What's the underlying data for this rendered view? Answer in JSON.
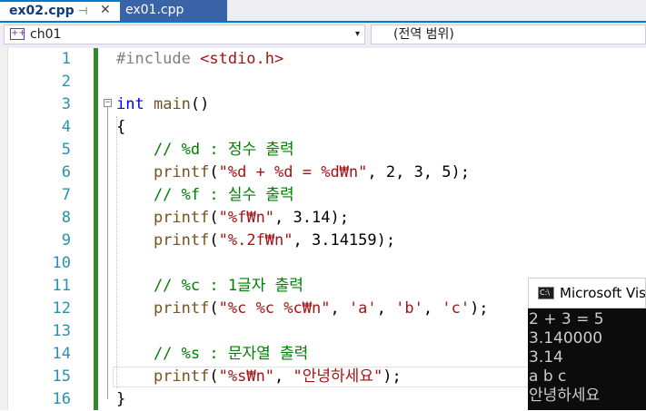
{
  "tabs": [
    {
      "label": "ex02.cpp",
      "active": true,
      "pin": "⊣",
      "close": "✕"
    },
    {
      "label": "ex01.cpp",
      "active": false
    }
  ],
  "navbar": {
    "scope_left": "ch01",
    "scope_right": "(전역 범위)",
    "dropdown_glyph": "▾"
  },
  "editor": {
    "lines": [
      {
        "n": "1",
        "segs": [
          {
            "t": "#include ",
            "c": "pp"
          },
          {
            "t": "<stdio.h>",
            "c": "str"
          }
        ]
      },
      {
        "n": "2",
        "segs": []
      },
      {
        "n": "3",
        "segs": [
          {
            "t": "int",
            "c": "kw"
          },
          {
            "t": " ",
            "c": ""
          },
          {
            "t": "main",
            "c": "fn"
          },
          {
            "t": "()",
            "c": ""
          }
        ]
      },
      {
        "n": "4",
        "segs": [
          {
            "t": "{",
            "c": ""
          }
        ]
      },
      {
        "n": "5",
        "segs": [
          {
            "t": "    // %d : 정수 출력",
            "c": "cm"
          }
        ]
      },
      {
        "n": "6",
        "segs": [
          {
            "t": "    ",
            "c": ""
          },
          {
            "t": "printf",
            "c": "fn"
          },
          {
            "t": "(",
            "c": ""
          },
          {
            "t": "\"%d + %d = %d₩n\"",
            "c": "str"
          },
          {
            "t": ", 2, 3, 5);",
            "c": ""
          }
        ]
      },
      {
        "n": "7",
        "segs": [
          {
            "t": "    // %f : 실수 출력",
            "c": "cm"
          }
        ]
      },
      {
        "n": "8",
        "segs": [
          {
            "t": "    ",
            "c": ""
          },
          {
            "t": "printf",
            "c": "fn"
          },
          {
            "t": "(",
            "c": ""
          },
          {
            "t": "\"%f₩n\"",
            "c": "str"
          },
          {
            "t": ", 3.14);",
            "c": ""
          }
        ]
      },
      {
        "n": "9",
        "segs": [
          {
            "t": "    ",
            "c": ""
          },
          {
            "t": "printf",
            "c": "fn"
          },
          {
            "t": "(",
            "c": ""
          },
          {
            "t": "\"%.2f₩n\"",
            "c": "str"
          },
          {
            "t": ", 3.14159);",
            "c": ""
          }
        ]
      },
      {
        "n": "10",
        "segs": []
      },
      {
        "n": "11",
        "segs": [
          {
            "t": "    // %c : 1글자 출력",
            "c": "cm"
          }
        ]
      },
      {
        "n": "12",
        "segs": [
          {
            "t": "    ",
            "c": ""
          },
          {
            "t": "printf",
            "c": "fn"
          },
          {
            "t": "(",
            "c": ""
          },
          {
            "t": "\"%c %c %c₩n\"",
            "c": "str"
          },
          {
            "t": ", ",
            "c": ""
          },
          {
            "t": "'a'",
            "c": "str"
          },
          {
            "t": ", ",
            "c": ""
          },
          {
            "t": "'b'",
            "c": "str"
          },
          {
            "t": ", ",
            "c": ""
          },
          {
            "t": "'c'",
            "c": "str"
          },
          {
            "t": ");",
            "c": ""
          }
        ]
      },
      {
        "n": "13",
        "segs": []
      },
      {
        "n": "14",
        "segs": [
          {
            "t": "    // %s : 문자열 출력",
            "c": "cm"
          }
        ]
      },
      {
        "n": "15",
        "segs": [
          {
            "t": "    ",
            "c": ""
          },
          {
            "t": "printf",
            "c": "fn"
          },
          {
            "t": "(",
            "c": ""
          },
          {
            "t": "\"%s₩n\"",
            "c": "str"
          },
          {
            "t": ", ",
            "c": ""
          },
          {
            "t": "\"안녕하세요\"",
            "c": "str"
          },
          {
            "t": ");",
            "c": ""
          }
        ]
      },
      {
        "n": "16",
        "segs": [
          {
            "t": "}",
            "c": ""
          }
        ]
      }
    ],
    "fold_glyph": "−"
  },
  "console": {
    "title": "Microsoft Visual Studio 디버그 콘솔",
    "icon_text": "C:\\",
    "output": [
      "2 + 3 = 5",
      "3.140000",
      "3.14",
      "a b c",
      "안녕하세요"
    ]
  },
  "colors": {
    "accent": "#007acc",
    "keyword": "#0000ff",
    "string": "#a31515",
    "comment": "#008000",
    "line_number": "#2b91af",
    "change_bar": "#2e8b2e"
  }
}
